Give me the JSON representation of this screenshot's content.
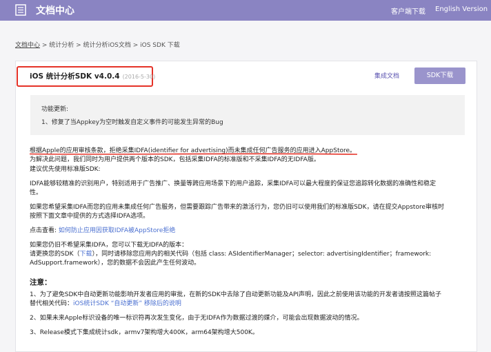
{
  "header": {
    "app_title": "文档中心",
    "nav_download": "客户端下载",
    "nav_english": "English Version"
  },
  "breadcrumb": {
    "items": [
      "文档中心",
      "统计分析",
      "统计分析iOS文档",
      "iOS SDK 下载"
    ],
    "separator": " > "
  },
  "sdk": {
    "title": "iOS 统计分析SDK v4.0.4",
    "date": "(2016-5-30)",
    "doc_link": "集成文档",
    "download_button": "SDK下载"
  },
  "update": {
    "title": "功能更新:",
    "item": "1、修复了当Appkey为空时触发自定义事件的可能发生异常的Bug"
  },
  "body": {
    "p1": "根据Apple的应用审核条款，拒绝采集IDFA(identifier for advertising)而未集成任何广告服务的应用进入AppStore。",
    "p2": "为解决此问题，我们同时为用户提供两个版本的SDK，包括采集IDFA的标准版和不采集IDFA的无IDFA版。",
    "p3": "建议优先使用标准版SDK:",
    "p4a": "IDFA能够较精准的识别用户，特别适用于广告推广、换量等跨应用场景下的用户追踪，采集IDFA可以最大程度的保证您追踪转化数据的准确性和稳定",
    "p4b": "性。",
    "p5a": "如果您希望采集IDFA而您的应用未集成任何广告服务，但需要跟踪广告带来的激活行为，您仍旧可以使用我们的标准版SDK，请在提交Appstore审核时",
    "p5b": "按照下面文章中提供的方式选择IDFA选项。",
    "p6_label": "点击查看:",
    "p6_link": "如何防止应用因获取IDFA被AppStore拒绝",
    "p7": "如果您仍旧不希望采集IDFA，您可以下载无IDFA的版本：",
    "p8a_pre": "请更换您的SDK（",
    "p8a_link": "下载",
    "p8a_post": "），同时请移除您应用内的相关代码（包括 class: ASIdentifierManager；selector: advertisingIdentifier；framework:",
    "p8b": "AdSupport.framework），您的数据不会因此产生任何波动。"
  },
  "notes": {
    "title": "注意：",
    "n1a": "1、为了避免SDK中自动更新功能影响开发者应用的审批，在新的SDK中去除了自动更新功能及API声明，因此之前使用该功能的开发者请按照这篇帖子",
    "n1b_pre": "替代相关代码：",
    "n1b_link": "iOS统计SDK “自动更新” 移除后的说明",
    "n2": "2、如果未来Apple标识设备的唯一标识符再次发生变化，由于无IDFA作为数据过渡的媒介，可能会出现数据波动的情况。",
    "n3": "3、Release模式下集成统计sdk，armv7架构增大400K，arm64架构增大500K。"
  },
  "colors": {
    "header_bg": "#8a84c2",
    "button_bg": "#9a94cc",
    "highlight": "#e53126",
    "link": "#4a6fd0"
  },
  "icons": [
    "document-icon"
  ]
}
